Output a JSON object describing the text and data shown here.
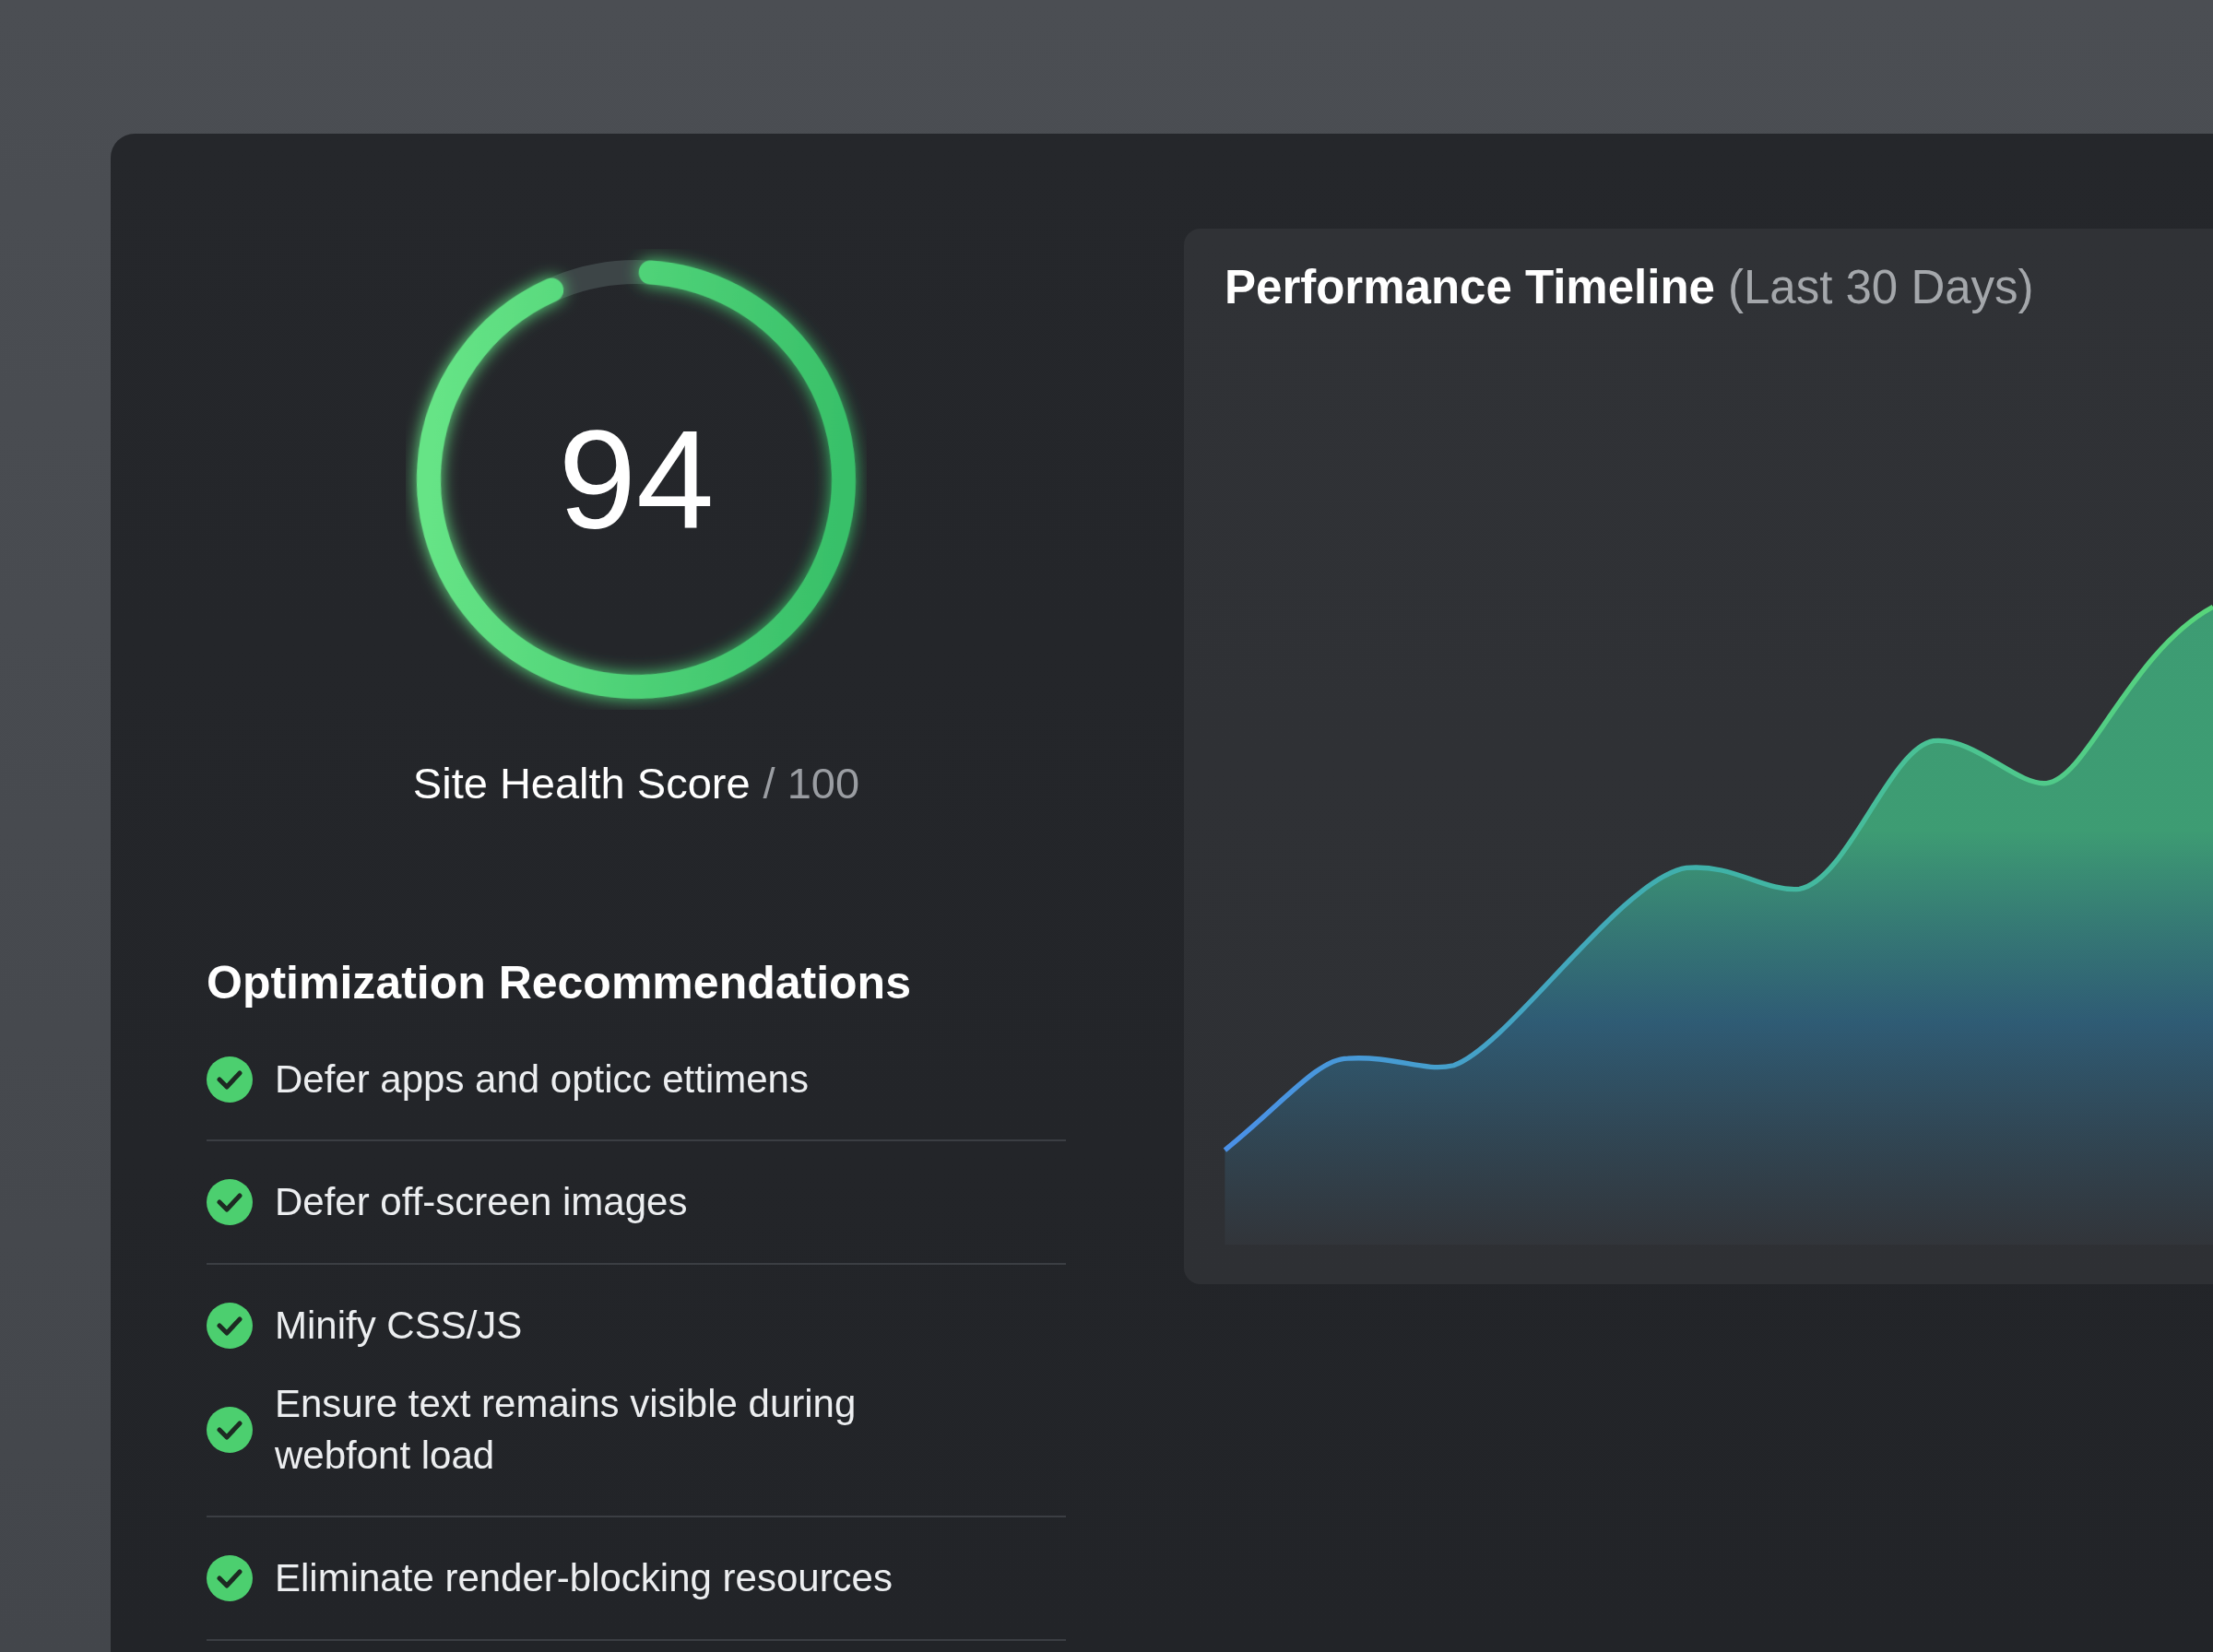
{
  "score": {
    "value": "94",
    "level": 0.94,
    "label": "Site Health Score",
    "max": "/ 100"
  },
  "recommendations": {
    "title": "Optimization Recommendations",
    "items": [
      {
        "text": "Defer apps and opticc ettimens",
        "done": true,
        "separated": true
      },
      {
        "text": "Defer off-screen images",
        "done": true,
        "separated": true
      },
      {
        "text": "Minify CSS/JS",
        "done": true,
        "separated": false
      },
      {
        "text": "Ensure text remains visible during webfont load",
        "done": true,
        "separated": true
      },
      {
        "text": "Eliminate render-blocking resources",
        "done": true,
        "separated": true
      }
    ]
  },
  "timeline": {
    "title": "Performance Timeline",
    "subtitle": "(Last 30 Days)"
  }
}
